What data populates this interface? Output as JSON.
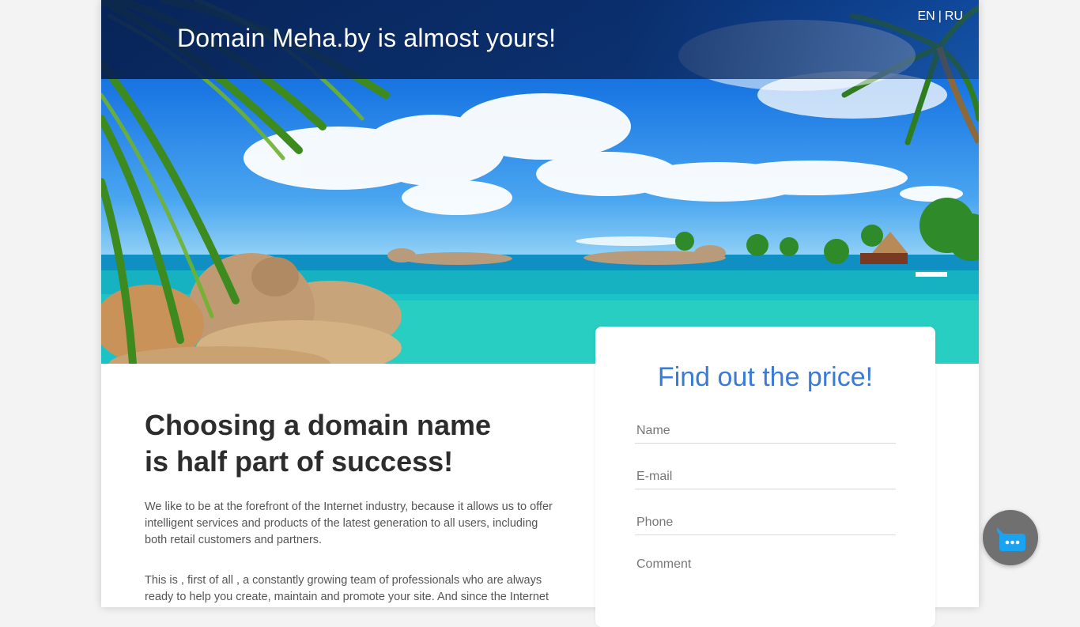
{
  "header": {
    "title": "Domain Meha.by is almost yours!",
    "languages": [
      {
        "code": "EN",
        "label": "EN"
      },
      {
        "code": "RU",
        "label": "RU"
      }
    ],
    "separator": "|"
  },
  "hero": {
    "image": "tropical-beach-scene"
  },
  "content": {
    "headline_line1": "Choosing a domain name",
    "headline_line2": "is half part of success!",
    "paragraph1": "We like to be at the forefront of the Internet industry, because it allows us to offer intelligent services and products of the latest generation to all users, including both retail customers and partners.",
    "paragraph2": "This is , first of all , a constantly growing team of professionals who are always ready to help you create, maintain and promote your site. And since the Internet is the future, we invite you to create the future together!"
  },
  "form": {
    "title": "Find out the price!",
    "name_placeholder": "Name",
    "email_placeholder": "E-mail",
    "phone_placeholder": "Phone",
    "comment_placeholder": "Comment"
  },
  "chat_widget": {
    "icon": "chat-bubble-icon"
  },
  "colors": {
    "accent": "#3a7bd5",
    "header_bar": "#0a2a5f",
    "chat_bg": "#707070",
    "chat_icon": "#1aa3f0"
  }
}
